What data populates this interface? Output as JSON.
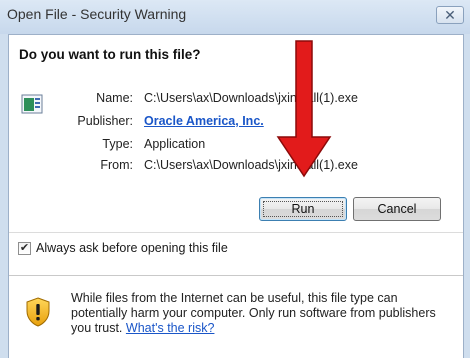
{
  "window": {
    "title": "Open File - Security Warning",
    "close_glyph": "✕"
  },
  "dialog": {
    "heading": "Do you want to run this file?",
    "file_icon": "program-icon",
    "fields": [
      {
        "label": "Name:",
        "value": "C:\\Users\\ax\\Downloads\\jxinstall(1).exe"
      },
      {
        "label": "Publisher:",
        "value": "Oracle America, Inc."
      },
      {
        "label": "Type:",
        "value": "Application"
      },
      {
        "label": "From:",
        "value": "C:\\Users\\ax\\Downloads\\jxinstall(1).exe"
      }
    ],
    "run_label": "Run",
    "cancel_label": "Cancel",
    "checkbox": {
      "label": "Always ask before opening this file",
      "checked": true,
      "mark": "✔"
    },
    "warning": {
      "icon": "shield-warning-icon",
      "text": "While files from the Internet can be useful, this file type can potentially harm your computer. Only run software from publishers you trust.",
      "link": "What's the risk?"
    },
    "annotation": {
      "type": "red-arrow-pointing-down",
      "color": "#e21b1b"
    }
  },
  "colors": {
    "link": "#1a56c8",
    "titlebar": "#cfdeee",
    "arrow": "#e21b1b"
  }
}
